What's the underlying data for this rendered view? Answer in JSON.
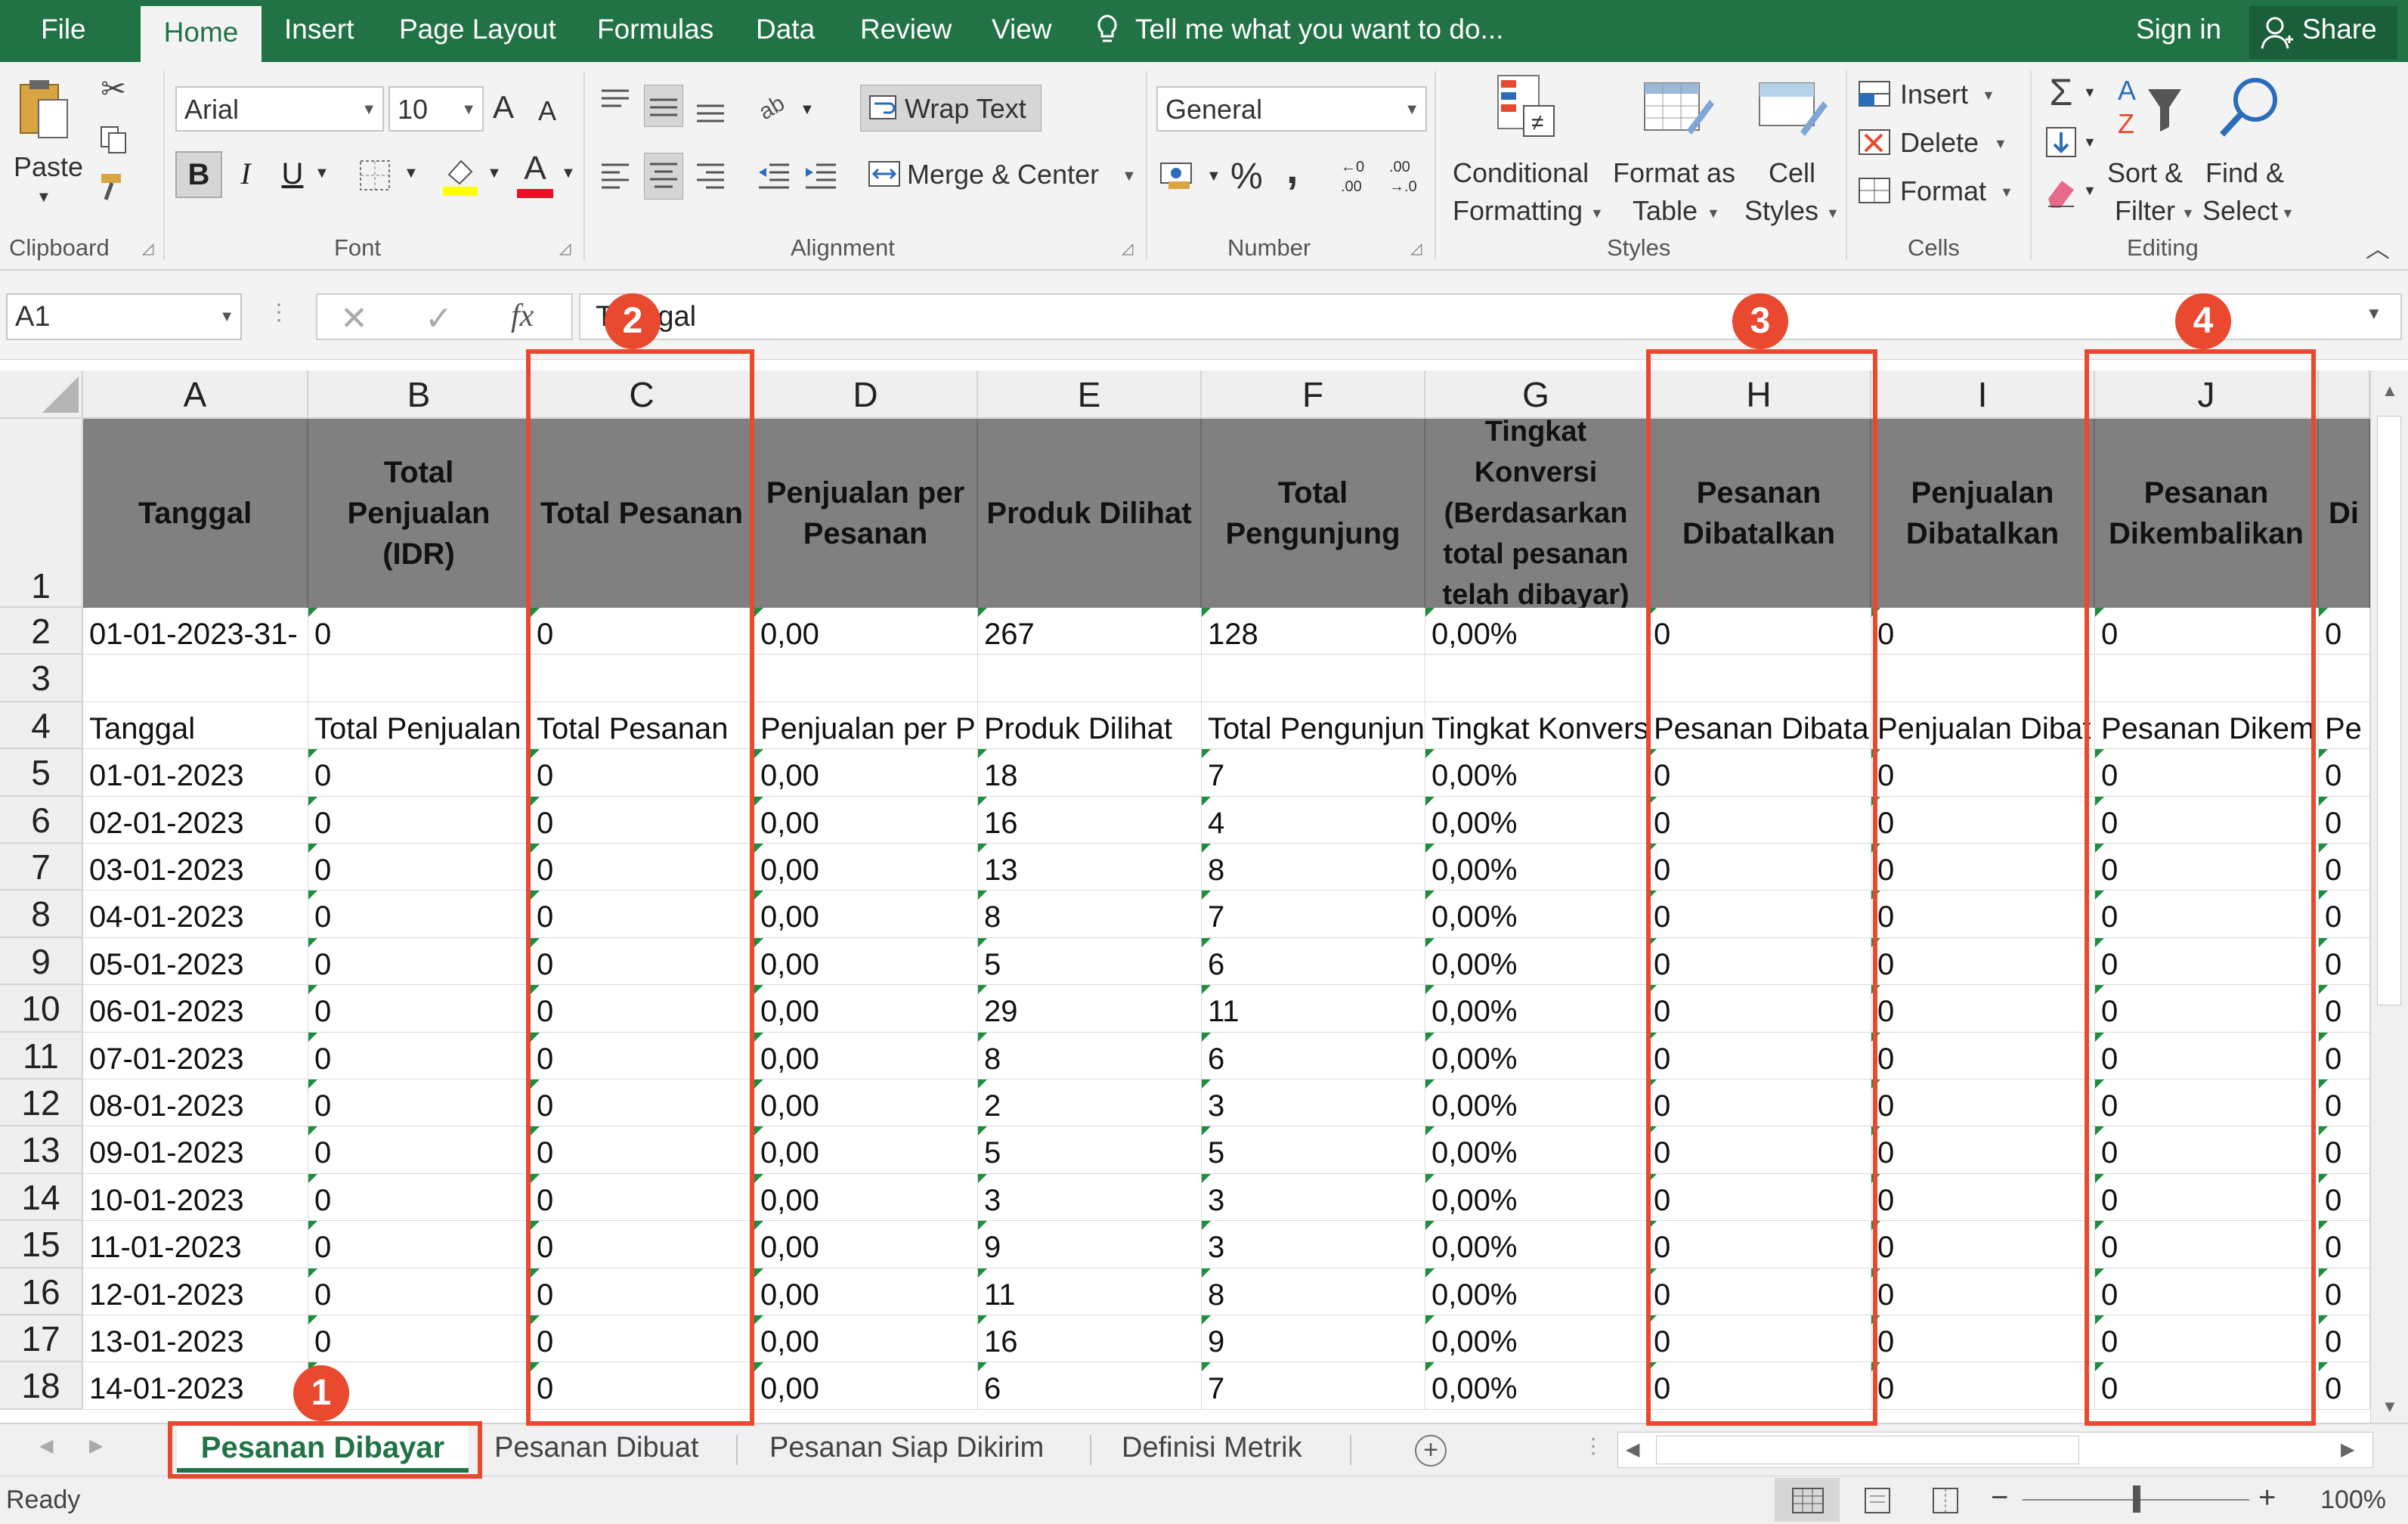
{
  "menu": {
    "file": "File",
    "home": "Home",
    "insert": "Insert",
    "page_layout": "Page Layout",
    "formulas": "Formulas",
    "data": "Data",
    "review": "Review",
    "view": "View",
    "tellme": "Tell me what you want to do...",
    "signin": "Sign in",
    "share": "Share"
  },
  "ribbon": {
    "clipboard": {
      "paste": "Paste",
      "label": "Clipboard"
    },
    "font": {
      "name": "Arial",
      "size": "10",
      "grow": "A",
      "shrink": "A",
      "bold": "B",
      "italic": "I",
      "underline": "U",
      "font_color_glyph": "A",
      "label": "Font"
    },
    "alignment": {
      "wrap_text": "Wrap Text",
      "merge_center": "Merge & Center",
      "label": "Alignment"
    },
    "number": {
      "format": "General",
      "percent": "%",
      "comma": ",",
      "label": "Number"
    },
    "styles": {
      "cond1": "Conditional",
      "cond2": "Formatting",
      "fmt1": "Format as",
      "fmt2": "Table",
      "cell1": "Cell",
      "cell2": "Styles",
      "label": "Styles"
    },
    "cells": {
      "insert": "Insert",
      "delete": "Delete",
      "format": "Format",
      "label": "Cells"
    },
    "editing": {
      "sort1": "Sort &",
      "sort2": "Filter",
      "find1": "Find &",
      "find2": "Select",
      "label": "Editing"
    }
  },
  "formula_bar": {
    "name_box": "A1",
    "fx": "fx",
    "content": "Tanggal"
  },
  "columns": [
    "A",
    "B",
    "C",
    "D",
    "E",
    "F",
    "G",
    "H",
    "I",
    "J"
  ],
  "row_numbers": [
    "1",
    "2",
    "3",
    "4",
    "5",
    "6",
    "7",
    "8",
    "9",
    "10",
    "11",
    "12",
    "13",
    "14",
    "15",
    "16",
    "17",
    "18"
  ],
  "header_row": [
    "Tanggal",
    "Total Penjualan (IDR)",
    "Total Pesanan",
    "Penjualan per Pesanan",
    "Produk Dilihat",
    "Total Pengunjung",
    "Tingkat Konversi (Berdasarkan total pesanan telah dibayar)",
    "Pesanan Dibatalkan",
    "Penjualan Dibatalkan",
    "Pesanan Dikembalikan",
    "Di"
  ],
  "row2": [
    "01-01-2023-31-",
    "0",
    "0",
    "0,00",
    "267",
    "128",
    "0,00%",
    "0",
    "0",
    "0",
    "0"
  ],
  "row4": [
    "Tanggal",
    "Total Penjualan",
    "Total Pesanan",
    "Penjualan per P",
    "Produk Dilihat",
    "Total Pengunjun",
    "Tingkat Konvers",
    "Pesanan Dibata",
    "Penjualan Dibat",
    "Pesanan Dikem",
    "Pe"
  ],
  "data_rows": [
    [
      "01-01-2023",
      "0",
      "0",
      "0,00",
      "18",
      "7",
      "0,00%",
      "0",
      "0",
      "0",
      "0"
    ],
    [
      "02-01-2023",
      "0",
      "0",
      "0,00",
      "16",
      "4",
      "0,00%",
      "0",
      "0",
      "0",
      "0"
    ],
    [
      "03-01-2023",
      "0",
      "0",
      "0,00",
      "13",
      "8",
      "0,00%",
      "0",
      "0",
      "0",
      "0"
    ],
    [
      "04-01-2023",
      "0",
      "0",
      "0,00",
      "8",
      "7",
      "0,00%",
      "0",
      "0",
      "0",
      "0"
    ],
    [
      "05-01-2023",
      "0",
      "0",
      "0,00",
      "5",
      "6",
      "0,00%",
      "0",
      "0",
      "0",
      "0"
    ],
    [
      "06-01-2023",
      "0",
      "0",
      "0,00",
      "29",
      "11",
      "0,00%",
      "0",
      "0",
      "0",
      "0"
    ],
    [
      "07-01-2023",
      "0",
      "0",
      "0,00",
      "8",
      "6",
      "0,00%",
      "0",
      "0",
      "0",
      "0"
    ],
    [
      "08-01-2023",
      "0",
      "0",
      "0,00",
      "2",
      "3",
      "0,00%",
      "0",
      "0",
      "0",
      "0"
    ],
    [
      "09-01-2023",
      "0",
      "0",
      "0,00",
      "5",
      "5",
      "0,00%",
      "0",
      "0",
      "0",
      "0"
    ],
    [
      "10-01-2023",
      "0",
      "0",
      "0,00",
      "3",
      "3",
      "0,00%",
      "0",
      "0",
      "0",
      "0"
    ],
    [
      "11-01-2023",
      "0",
      "0",
      "0,00",
      "9",
      "3",
      "0,00%",
      "0",
      "0",
      "0",
      "0"
    ],
    [
      "12-01-2023",
      "0",
      "0",
      "0,00",
      "11",
      "8",
      "0,00%",
      "0",
      "0",
      "0",
      "0"
    ],
    [
      "13-01-2023",
      "0",
      "0",
      "0,00",
      "16",
      "9",
      "0,00%",
      "0",
      "0",
      "0",
      "0"
    ],
    [
      "14-01-2023",
      "0",
      "0",
      "0,00",
      "6",
      "7",
      "0,00%",
      "0",
      "0",
      "0",
      "0"
    ]
  ],
  "sheet_tabs": [
    "Pesanan Dibayar",
    "Pesanan Dibuat",
    "Pesanan Siap Dikirim",
    "Definisi Metrik"
  ],
  "badges": [
    "1",
    "2",
    "3",
    "4"
  ],
  "status": {
    "ready": "Ready",
    "zoom": "100%"
  },
  "colors": {
    "excel_green": "#217346",
    "annotation_red": "#e8492f",
    "header_fill": "#808080"
  }
}
